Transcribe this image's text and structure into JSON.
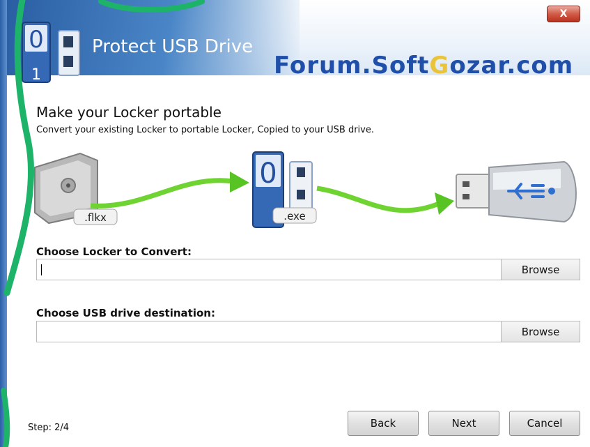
{
  "window": {
    "title": "Protect USB Drive",
    "watermark_prefix": "Forum.Soft",
    "watermark_g": "G",
    "watermark_suffix": "ozar.com",
    "close_label": "X"
  },
  "page": {
    "heading": "Make your Locker portable",
    "subheading": "Convert your existing Locker to portable Locker, Copied to your USB drive."
  },
  "illustration": {
    "source_ext": ".flkx",
    "target_ext": ".exe",
    "icons": [
      "safe-icon",
      "locker-app-icon",
      "usb-drive-icon",
      "arrow-icon"
    ]
  },
  "locker_field": {
    "label": "Choose Locker to Convert:",
    "value": "",
    "placeholder": "",
    "browse_label": "Browse"
  },
  "usb_field": {
    "label": "Choose USB drive destination:",
    "value": "",
    "placeholder": "",
    "browse_label": "Browse"
  },
  "footer": {
    "step": "Step: 2/4",
    "back_label": "Back",
    "next_label": "Next",
    "cancel_label": "Cancel"
  },
  "colors": {
    "title_blue": "#2a5ea3",
    "watermark_blue": "#1f4fa8",
    "arrow_green": "#6fd431",
    "close_red": "#c8412d"
  }
}
